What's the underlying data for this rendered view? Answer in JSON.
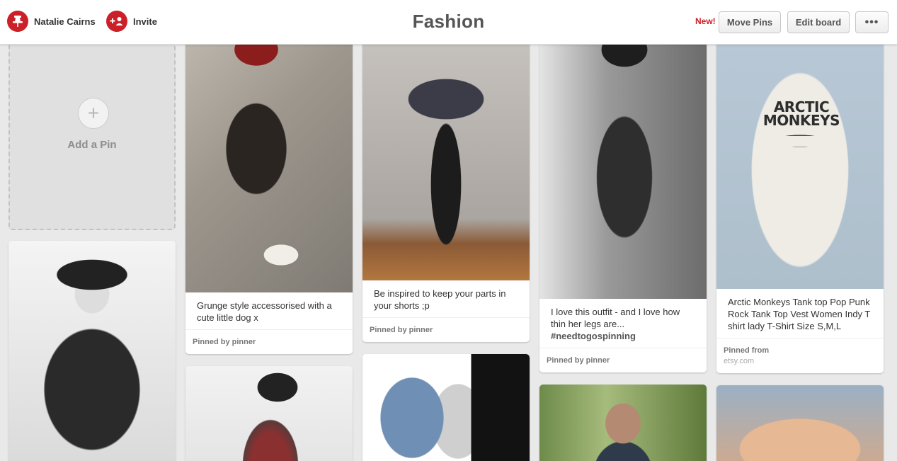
{
  "header": {
    "user_name": "Natalie Cairns",
    "invite_label": "Invite",
    "board_title": "Fashion",
    "new_badge": "New!",
    "move_pins_label": "Move Pins",
    "edit_board_label": "Edit board",
    "more_label": "•••",
    "brand_color": "#cb2027"
  },
  "add_pin": {
    "plus": "+",
    "label": "Add a Pin"
  },
  "pins": [
    {
      "description": "Grunge style accessorised with a cute little dog x",
      "pinned_label": "Pinned by pinner"
    },
    {
      "description": "Be inspired to keep your parts in your shorts ;p",
      "pinned_label": "Pinned by pinner"
    },
    {
      "description": "I love this outfit - and I love how thin her legs are...",
      "hashtag": "#needtogospinning",
      "pinned_label": "Pinned by pinner"
    },
    {
      "description": "Arctic Monkeys Tank top Pop Punk Rock Tank Top Vest Women Indy T shirt lady T-Shirt Size S,M,L",
      "pinned_label": "Pinned from",
      "source": "etsy.com",
      "shirt_print": "ARCTIC MONKEYS"
    }
  ]
}
